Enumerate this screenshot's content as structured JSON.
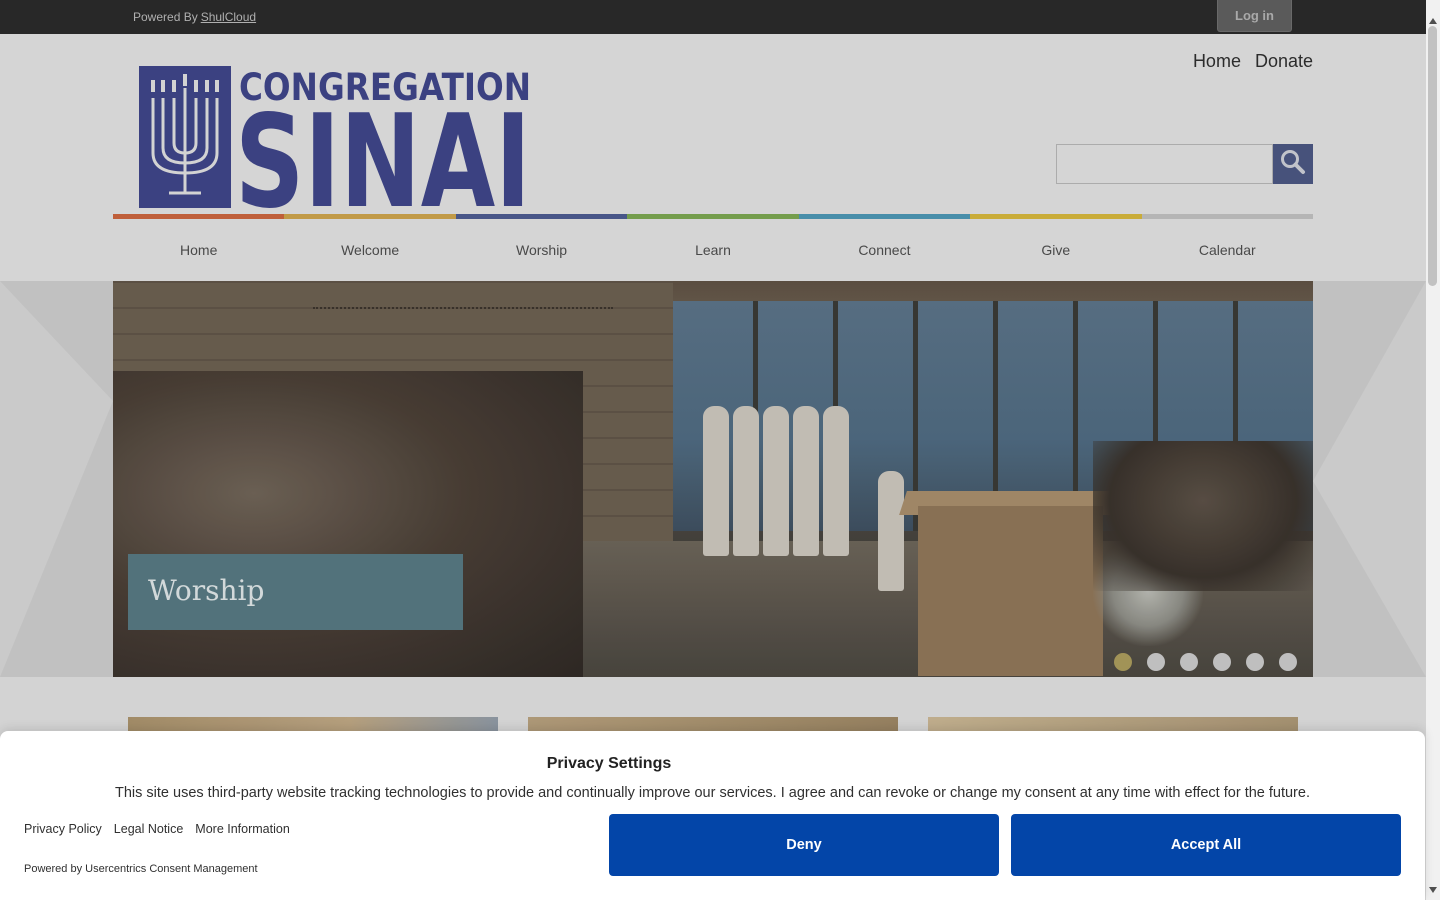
{
  "topbar": {
    "powered_by": "Powered By",
    "powered_link": "ShulCloud",
    "login": "Log in"
  },
  "header": {
    "logo_line1": "CONGREGATION",
    "logo_line2": "SINAI",
    "links": [
      "Home",
      "Donate"
    ],
    "search_placeholder": ""
  },
  "colorbar": [
    "#c7633d",
    "#c9a14a",
    "#4b5a8e",
    "#79a450",
    "#4b94b1",
    "#d2b43c",
    "#bdbdbd"
  ],
  "nav": [
    "Home",
    "Welcome",
    "Worship",
    "Learn",
    "Connect",
    "Give",
    "Calendar"
  ],
  "hero": {
    "caption": "Worship",
    "slide_count": 6,
    "active_slide": 1
  },
  "consent": {
    "title": "Privacy Settings",
    "body": "This site uses third-party website tracking technologies to provide and continually improve our services. I agree and can revoke or change my consent at any time with effect for the future.",
    "links": [
      "Privacy Policy",
      "Legal Notice",
      "More Information"
    ],
    "powered": "Powered by Usercentrics Consent Management",
    "deny": "Deny",
    "accept": "Accept All"
  },
  "colors": {
    "brand_navy": "#3e4487",
    "button_blue": "#0345a8",
    "caption_teal": "#567780"
  }
}
